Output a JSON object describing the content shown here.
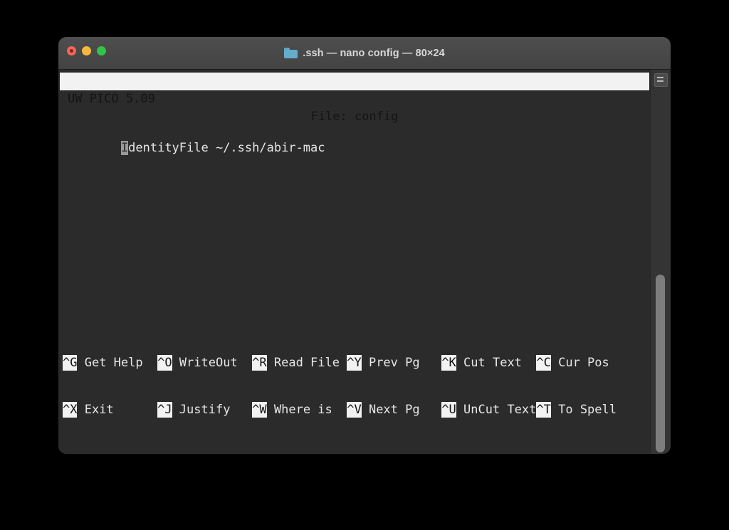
{
  "window": {
    "title": ".ssh — nano config — 80×24",
    "folder_icon": "folder-icon",
    "traffic_lights": [
      {
        "name": "close",
        "color": "#f2675a"
      },
      {
        "name": "minimize",
        "color": "#f6b83e"
      },
      {
        "name": "maximize",
        "color": "#31c545"
      }
    ],
    "background_color": "#2b2b2b",
    "titlebar_color": "#4a4a4a"
  },
  "editor": {
    "status_bar": {
      "left": "UW PICO 5.09",
      "center": "File: config"
    },
    "lines": [
      {
        "cursor_char": "I",
        "rest": "dentityFile ~/.ssh/abir-mac"
      }
    ],
    "full_line_text": "IdentityFile ~/.ssh/abir-mac",
    "shortcuts_row1": [
      {
        "key": "^G",
        "label": " Get Help  "
      },
      {
        "key": "^O",
        "label": " WriteOut  "
      },
      {
        "key": "^R",
        "label": " Read File "
      },
      {
        "key": "^Y",
        "label": " Prev Pg   "
      },
      {
        "key": "^K",
        "label": " Cut Text  "
      },
      {
        "key": "^C",
        "label": " Cur Pos"
      }
    ],
    "shortcuts_row2": [
      {
        "key": "^X",
        "label": " Exit      "
      },
      {
        "key": "^J",
        "label": " Justify   "
      },
      {
        "key": "^W",
        "label": " Where is  "
      },
      {
        "key": "^V",
        "label": " Next Pg   "
      },
      {
        "key": "^U",
        "label": " UnCut Text"
      },
      {
        "key": "^T",
        "label": " To Spell"
      }
    ]
  },
  "scrollbar": {
    "marker_icon": "scroll-marker-icon",
    "thumb_color": "#7d7d7d",
    "track_color": "#343434"
  }
}
